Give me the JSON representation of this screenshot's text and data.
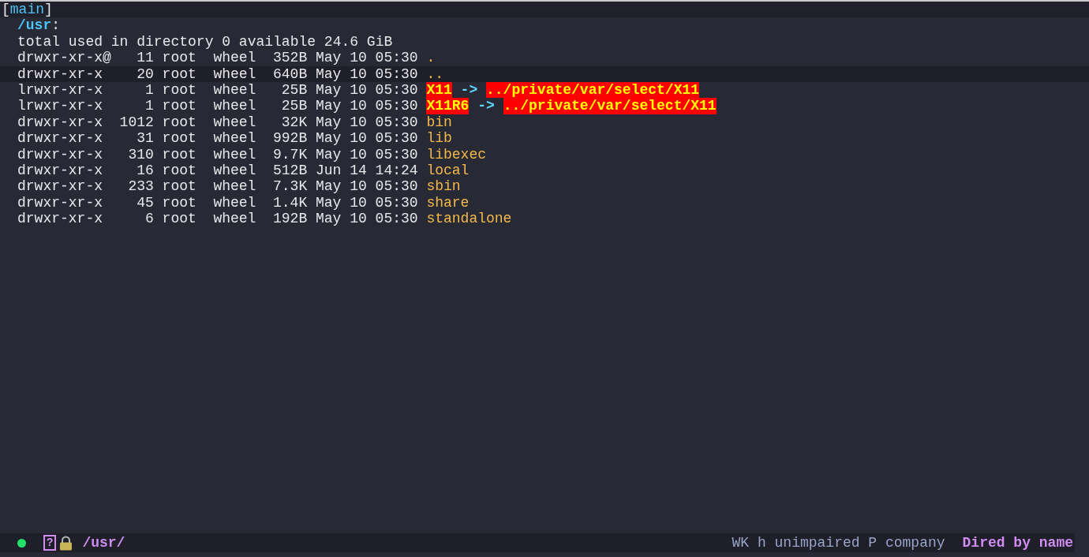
{
  "header": {
    "open": "[",
    "branch": "main",
    "close": "]"
  },
  "directory": {
    "path": "/usr",
    "colon": ":"
  },
  "summary": "total used in directory 0 available 24.6 GiB",
  "entries": [
    {
      "kind": "directory",
      "perms": "drwxr-xr-x@",
      "links": "11",
      "owner": "root",
      "group": "wheel",
      "size": "352B",
      "date": "May 10 05:30",
      "name": ".",
      "selected": false
    },
    {
      "kind": "directory",
      "perms": "drwxr-xr-x",
      "links": "20",
      "owner": "root",
      "group": "wheel",
      "size": "640B",
      "date": "May 10 05:30",
      "name": "..",
      "selected": true
    },
    {
      "kind": "symlink",
      "perms": "lrwxr-xr-x",
      "links": "1",
      "owner": "root",
      "group": "wheel",
      "size": "25B",
      "date": "May 10 05:30",
      "name": "X11",
      "arrow": "->",
      "target": "../private/var/select/X11",
      "selected": false
    },
    {
      "kind": "symlink",
      "perms": "lrwxr-xr-x",
      "links": "1",
      "owner": "root",
      "group": "wheel",
      "size": "25B",
      "date": "May 10 05:30",
      "name": "X11R6",
      "arrow": "->",
      "target": "../private/var/select/X11",
      "selected": false
    },
    {
      "kind": "directory",
      "perms": "drwxr-xr-x",
      "links": "1012",
      "owner": "root",
      "group": "wheel",
      "size": "32K",
      "date": "May 10 05:30",
      "name": "bin",
      "selected": false
    },
    {
      "kind": "directory",
      "perms": "drwxr-xr-x",
      "links": "31",
      "owner": "root",
      "group": "wheel",
      "size": "992B",
      "date": "May 10 05:30",
      "name": "lib",
      "selected": false
    },
    {
      "kind": "directory",
      "perms": "drwxr-xr-x",
      "links": "310",
      "owner": "root",
      "group": "wheel",
      "size": "9.7K",
      "date": "May 10 05:30",
      "name": "libexec",
      "selected": false
    },
    {
      "kind": "directory",
      "perms": "drwxr-xr-x",
      "links": "16",
      "owner": "root",
      "group": "wheel",
      "size": "512B",
      "date": "Jun 14 14:24",
      "name": "local",
      "selected": false
    },
    {
      "kind": "directory",
      "perms": "drwxr-xr-x",
      "links": "233",
      "owner": "root",
      "group": "wheel",
      "size": "7.3K",
      "date": "May 10 05:30",
      "name": "sbin",
      "selected": false
    },
    {
      "kind": "directory",
      "perms": "drwxr-xr-x",
      "links": "45",
      "owner": "root",
      "group": "wheel",
      "size": "1.4K",
      "date": "May 10 05:30",
      "name": "share",
      "selected": false
    },
    {
      "kind": "directory",
      "perms": "drwxr-xr-x",
      "links": "6",
      "owner": "root",
      "group": "wheel",
      "size": "192B",
      "date": "May 10 05:30",
      "name": "standalone",
      "selected": false
    }
  ],
  "status_bar": {
    "readonly_marker": "?",
    "path": "/usr/",
    "info": "WK h unimpaired P company",
    "mode": "Dired by name"
  }
}
